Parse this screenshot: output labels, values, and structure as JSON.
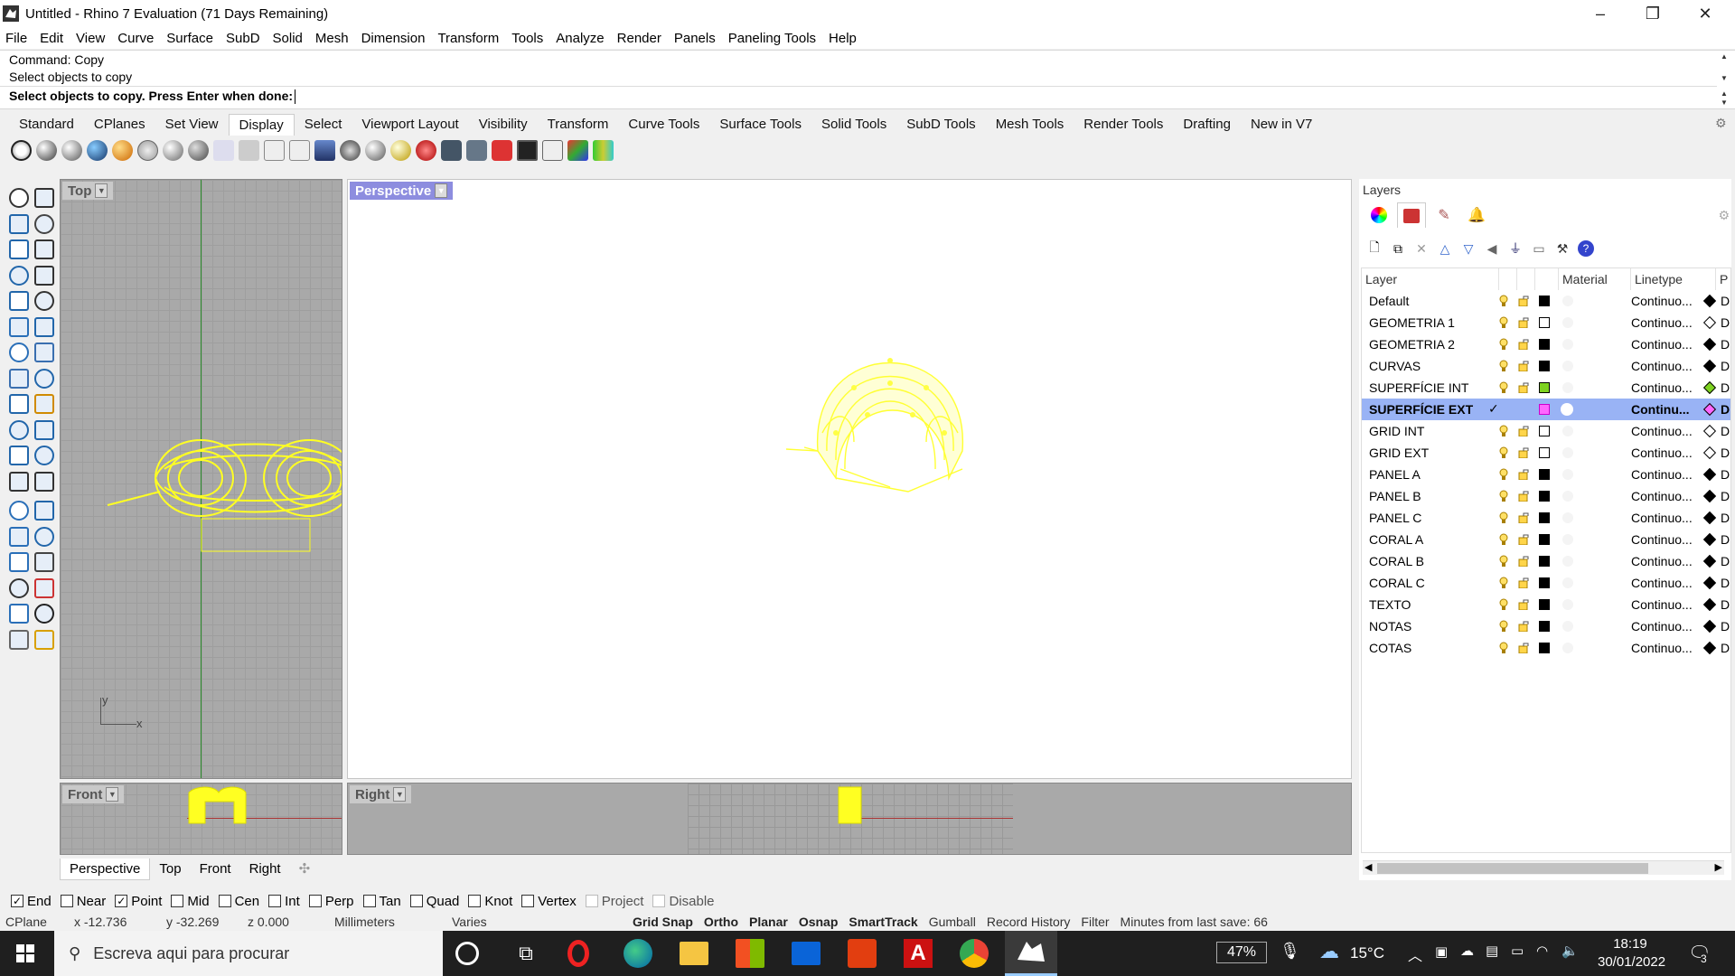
{
  "window": {
    "title": "Untitled - Rhino 7 Evaluation (71 Days Remaining)",
    "min_glyph": "–",
    "max_glyph": "❐",
    "close_glyph": "✕"
  },
  "menu": [
    "File",
    "Edit",
    "View",
    "Curve",
    "Surface",
    "SubD",
    "Solid",
    "Mesh",
    "Dimension",
    "Transform",
    "Tools",
    "Analyze",
    "Render",
    "Panels",
    "Paneling Tools",
    "Help"
  ],
  "command": {
    "history": [
      "Command: Copy",
      "Select objects to copy"
    ],
    "prompt": "Select objects to copy. Press Enter when done:"
  },
  "toolbar_tabs": [
    "Standard",
    "CPlanes",
    "Set View",
    "Display",
    "Select",
    "Viewport Layout",
    "Visibility",
    "Transform",
    "Curve Tools",
    "Surface Tools",
    "Solid Tools",
    "SubD Tools",
    "Mesh Tools",
    "Render Tools",
    "Drafting",
    "New in V7"
  ],
  "active_toolbar_tab": "Display",
  "viewports": {
    "top": "Top",
    "perspective": "Perspective",
    "front": "Front",
    "right": "Right",
    "axis_y": "y",
    "axis_x": "x"
  },
  "viewport_tabs": [
    "Perspective",
    "Top",
    "Front",
    "Right"
  ],
  "viewport_tab_add": "✣",
  "layers_panel": {
    "title": "Layers",
    "headers": {
      "layer": "Layer",
      "material": "Material",
      "linetype": "Linetype",
      "print": "P"
    },
    "rows": [
      {
        "name": "Default",
        "color": "#000000",
        "linetype": "Continuo...",
        "selected": false
      },
      {
        "name": "GEOMETRIA 1",
        "color": "#ffffff",
        "linetype": "Continuo...",
        "selected": false
      },
      {
        "name": "GEOMETRIA 2",
        "color": "#000000",
        "linetype": "Continuo...",
        "selected": false
      },
      {
        "name": "CURVAS",
        "color": "#000000",
        "linetype": "Continuo...",
        "selected": false
      },
      {
        "name": "SUPERFÍCIE INT",
        "color": "#7ed321",
        "linetype": "Continuo...",
        "selected": false
      },
      {
        "name": "SUPERFÍCIE EXT",
        "color": "#ff66ff",
        "linetype": "Continu...",
        "selected": true
      },
      {
        "name": "GRID INT",
        "color": "#ffffff",
        "linetype": "Continuo...",
        "selected": false
      },
      {
        "name": "GRID EXT",
        "color": "#ffffff",
        "linetype": "Continuo...",
        "selected": false
      },
      {
        "name": "PANEL A",
        "color": "#000000",
        "linetype": "Continuo...",
        "selected": false
      },
      {
        "name": "PANEL B",
        "color": "#000000",
        "linetype": "Continuo...",
        "selected": false
      },
      {
        "name": "PANEL C",
        "color": "#000000",
        "linetype": "Continuo...",
        "selected": false
      },
      {
        "name": "CORAL A",
        "color": "#000000",
        "linetype": "Continuo...",
        "selected": false
      },
      {
        "name": "CORAL B",
        "color": "#000000",
        "linetype": "Continuo...",
        "selected": false
      },
      {
        "name": "CORAL C",
        "color": "#000000",
        "linetype": "Continuo...",
        "selected": false
      },
      {
        "name": "TEXTO",
        "color": "#000000",
        "linetype": "Continuo...",
        "selected": false
      },
      {
        "name": "NOTAS",
        "color": "#000000",
        "linetype": "Continuo...",
        "selected": false
      },
      {
        "name": "COTAS",
        "color": "#000000",
        "linetype": "Continuo...",
        "selected": false
      }
    ],
    "print_char": "D",
    "check_mark": "✓"
  },
  "osnap": [
    {
      "label": "End",
      "checked": true,
      "disabled": false
    },
    {
      "label": "Near",
      "checked": false,
      "disabled": false
    },
    {
      "label": "Point",
      "checked": true,
      "disabled": false
    },
    {
      "label": "Mid",
      "checked": false,
      "disabled": false
    },
    {
      "label": "Cen",
      "checked": false,
      "disabled": false
    },
    {
      "label": "Int",
      "checked": false,
      "disabled": false
    },
    {
      "label": "Perp",
      "checked": false,
      "disabled": false
    },
    {
      "label": "Tan",
      "checked": false,
      "disabled": false
    },
    {
      "label": "Quad",
      "checked": false,
      "disabled": false
    },
    {
      "label": "Knot",
      "checked": false,
      "disabled": false
    },
    {
      "label": "Vertex",
      "checked": false,
      "disabled": false
    },
    {
      "label": "Project",
      "checked": false,
      "disabled": true
    },
    {
      "label": "Disable",
      "checked": false,
      "disabled": true
    }
  ],
  "status": {
    "cplane": "CPlane",
    "x": "x -12.736",
    "y": "y -32.269",
    "z": "z 0.000",
    "units": "Millimeters",
    "layer": "Varies",
    "toggles": [
      {
        "label": "Grid Snap",
        "on": true
      },
      {
        "label": "Ortho",
        "on": true
      },
      {
        "label": "Planar",
        "on": true
      },
      {
        "label": "Osnap",
        "on": true
      },
      {
        "label": "SmartTrack",
        "on": true
      },
      {
        "label": "Gumball",
        "on": false
      },
      {
        "label": "Record History",
        "on": false
      },
      {
        "label": "Filter",
        "on": false
      }
    ],
    "save_info": "Minutes from last save: 66"
  },
  "taskbar": {
    "search_placeholder": "Escreva aqui para procurar",
    "battery": "47%",
    "temperature": "15°C",
    "time": "18:19",
    "date": "30/01/2022",
    "notifications": "3"
  }
}
